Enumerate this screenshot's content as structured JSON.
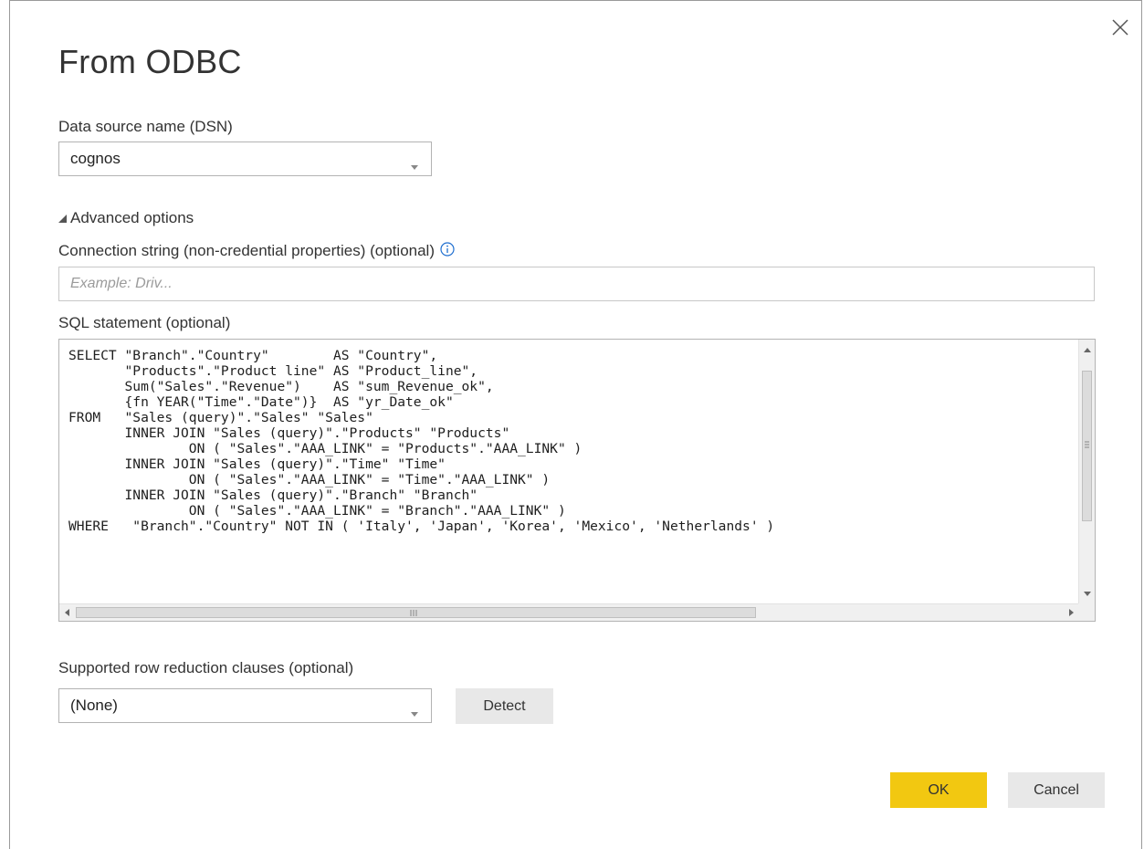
{
  "dialog": {
    "title": "From ODBC",
    "close_icon": "close-icon"
  },
  "dsn": {
    "label": "Data source name (DSN)",
    "value": "cognos"
  },
  "advanced": {
    "toggle_label": "Advanced options",
    "connection_label": "Connection string (non-credential properties) (optional)",
    "connection_placeholder": "Example: Driv...",
    "sql_label": "SQL statement (optional)",
    "sql_text": "SELECT \"Branch\".\"Country\"        AS \"Country\",\n       \"Products\".\"Product line\" AS \"Product_line\",\n       Sum(\"Sales\".\"Revenue\")    AS \"sum_Revenue_ok\",\n       {fn YEAR(\"Time\".\"Date\")}  AS \"yr_Date_ok\"\nFROM   \"Sales (query)\".\"Sales\" \"Sales\"\n       INNER JOIN \"Sales (query)\".\"Products\" \"Products\"\n               ON ( \"Sales\".\"AAA_LINK\" = \"Products\".\"AAA_LINK\" )\n       INNER JOIN \"Sales (query)\".\"Time\" \"Time\"\n               ON ( \"Sales\".\"AAA_LINK\" = \"Time\".\"AAA_LINK\" )\n       INNER JOIN \"Sales (query)\".\"Branch\" \"Branch\"\n               ON ( \"Sales\".\"AAA_LINK\" = \"Branch\".\"AAA_LINK\" )\nWHERE   \"Branch\".\"Country\" NOT IN ( 'Italy', 'Japan', 'Korea', 'Mexico', 'Netherlands' )"
  },
  "row_reduction": {
    "label": "Supported row reduction clauses (optional)",
    "value": "(None)",
    "detect_label": "Detect"
  },
  "footer": {
    "ok_label": "OK",
    "cancel_label": "Cancel"
  },
  "colors": {
    "ok_button": "#f2c811",
    "info_icon": "#1f6fd0"
  }
}
